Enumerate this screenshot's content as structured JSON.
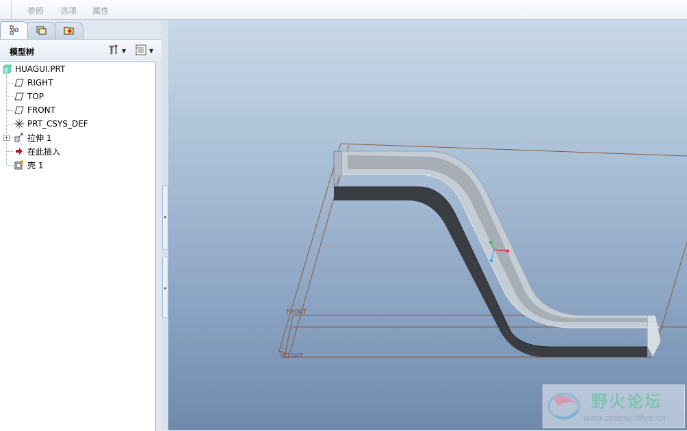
{
  "menubar": {
    "items": [
      {
        "label": "参照"
      },
      {
        "label": "选项"
      },
      {
        "label": "属性"
      }
    ]
  },
  "panel": {
    "tabs": [
      {
        "icon": "model-tree-icon"
      },
      {
        "icon": "folder-browser-icon"
      },
      {
        "icon": "favorites-icon"
      }
    ],
    "header_title": "模型树",
    "settings_icon": "tools-icon",
    "show_icon": "show-list-icon"
  },
  "tree": {
    "root": {
      "label": "HUAGUI.PRT",
      "icon": "part-icon"
    },
    "items": [
      {
        "label": "RIGHT",
        "icon": "datum-plane-icon"
      },
      {
        "label": "TOP",
        "icon": "datum-plane-icon"
      },
      {
        "label": "FRONT",
        "icon": "datum-plane-icon"
      },
      {
        "label": "PRT_CSYS_DEF",
        "icon": "csys-icon"
      },
      {
        "label": "拉伸 1",
        "icon": "extrude-icon",
        "expandable": true
      },
      {
        "label": "在此插入",
        "icon": "insert-arrow-icon"
      },
      {
        "label": "壳 1",
        "icon": "shell-icon"
      }
    ]
  },
  "viewport": {
    "datum_labels": {
      "front": "FRONT",
      "right": "RIGHT"
    }
  },
  "watermark": {
    "title": "野火论坛",
    "url": "www.proewildfire.cn"
  },
  "colors": {
    "datum_plane": "#8a5a3a",
    "model_face": "#c4ccd6",
    "model_dark": "#3a3d42",
    "axis_x": "#e02020",
    "axis_y": "#20c040",
    "axis_z": "#30b0e0"
  }
}
